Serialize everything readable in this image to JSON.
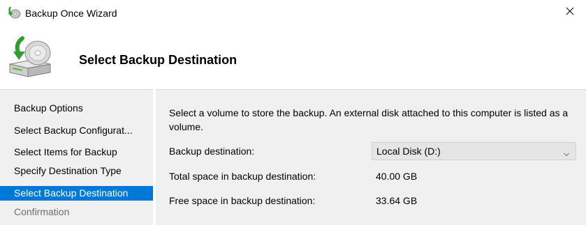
{
  "window": {
    "title": "Backup Once Wizard"
  },
  "header": {
    "title": "Select Backup Destination"
  },
  "nav": {
    "items": [
      {
        "label": "Backup Options",
        "state": "normal"
      },
      {
        "label": "Select Backup Configurat...",
        "state": "normal"
      },
      {
        "label": "Select Items for Backup",
        "state": "normal"
      },
      {
        "label": "Specify Destination Type",
        "state": "normal"
      },
      {
        "label": "Select Backup Destination",
        "state": "selected"
      },
      {
        "label": "Confirmation",
        "state": "disabled"
      }
    ]
  },
  "content": {
    "description": "Select a volume to store the backup. An external disk attached to this computer is listed as a volume.",
    "destination": {
      "label": "Backup destination:",
      "selected": "Local Disk (D:)"
    },
    "total_space": {
      "label": "Total space in backup destination:",
      "value": "40.00 GB"
    },
    "free_space": {
      "label": "Free space in backup destination:",
      "value": "33.64 GB"
    }
  },
  "icons": {
    "title": "backup-wizard-icon",
    "header": "disk-backup-icon",
    "close": "close-icon",
    "dropdown": "chevron-down-icon"
  },
  "colors": {
    "selection": "#0078d7",
    "pane_background": "#f0f0f0",
    "disabled_text": "#6d6d6d"
  }
}
